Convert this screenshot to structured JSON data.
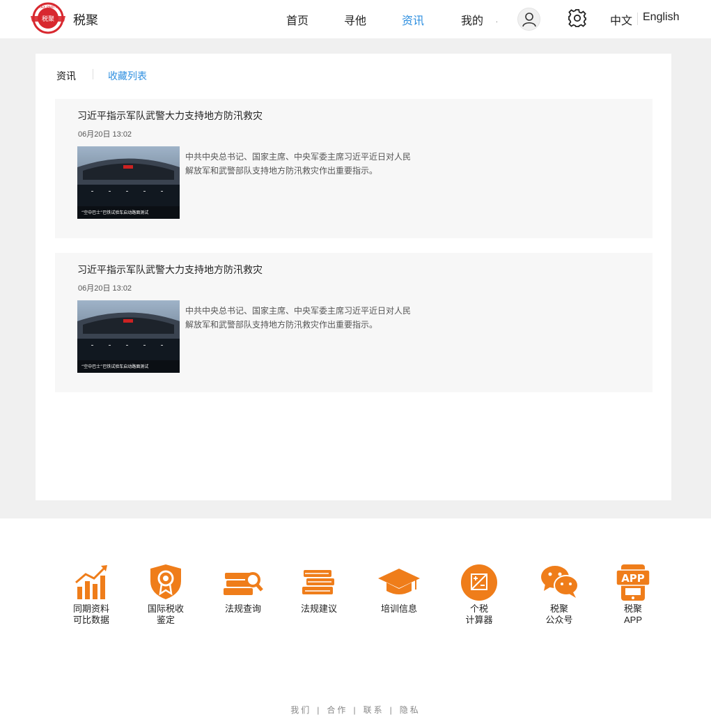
{
  "header": {
    "logo_text": "税聚",
    "logo_ring_text": "TAX PARTY",
    "brand": "税聚",
    "nav": [
      "首页",
      "寻他",
      "资讯",
      "我的"
    ],
    "active_nav": "资讯",
    "lang_cn": "中文",
    "lang_en": "English"
  },
  "tabs": {
    "current": "资讯",
    "favorites": "收藏列表"
  },
  "news": [
    {
      "title": "习近平指示军队武警大力支持地方防汛救灾",
      "time": "06月20日  13:02",
      "desc": "中共中央总书记、国家主席、中央军委主席习近平近日对人民解放军和武警部队支持地方防汛救灾作出重要指示。",
      "image_caption": "“空中巴士”巴铁试验车启动路面测试"
    },
    {
      "title": "习近平指示军队武警大力支持地方防汛救灾",
      "time": "06月20日  13:02",
      "desc": "中共中央总书记、国家主席、中央军委主席习近平近日对人民解放军和武警部队支持地方防汛救灾作出重要指示。",
      "image_caption": "“空中巴士”巴铁试验车启动路面测试"
    }
  ],
  "footer": {
    "items": [
      {
        "label": "同期资料\n可比数据",
        "icon": "bar-chart-icon"
      },
      {
        "label": "国际税收\n鉴定",
        "icon": "badge-shield-icon"
      },
      {
        "label": "法规查询",
        "icon": "book-search-icon"
      },
      {
        "label": "法规建议",
        "icon": "books-icon"
      },
      {
        "label": "培训信息",
        "icon": "graduation-cap-icon"
      },
      {
        "label": "个税\n计算器",
        "icon": "calculator-icon"
      },
      {
        "label": "税聚\n公众号",
        "icon": "wechat-icon"
      },
      {
        "label": "税聚\nAPP",
        "icon": "app-icon"
      }
    ],
    "app_badge": "APP",
    "links": [
      "我们",
      "合作",
      "联系",
      "隐私"
    ]
  },
  "colors": {
    "accent": "#2e8fe0",
    "footer_icon": "#ef7d1a",
    "logo_red": "#d8282f"
  }
}
